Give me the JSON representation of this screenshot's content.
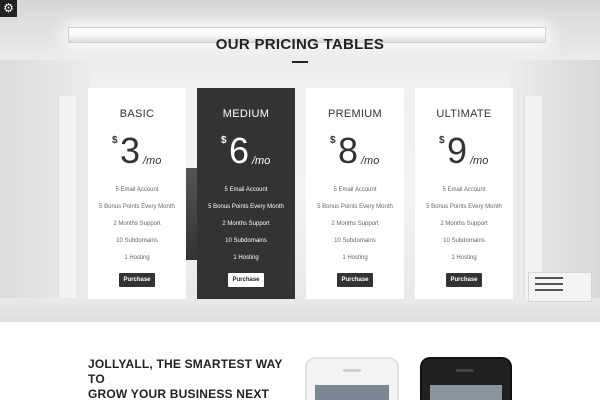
{
  "toolbar": {
    "settings_icon": "gear-icon"
  },
  "pricing": {
    "title": "OUR PRICING TABLES",
    "plans": [
      {
        "name": "BASIC",
        "currency": "$",
        "price": "3",
        "period": "/mo",
        "featured": false,
        "features": [
          "5 Email Account",
          "5 Bonus Points Every Month",
          "2 Months Support",
          "10 Subdomains",
          "1 Hosting"
        ],
        "button_label": "Purchase"
      },
      {
        "name": "MEDIUM",
        "currency": "$",
        "price": "6",
        "period": "/mo",
        "featured": true,
        "features": [
          "5 Email Account",
          "5 Bonus Points Every Month",
          "2 Months Support",
          "10 Subdomains",
          "1 Hosting"
        ],
        "button_label": "Purchase"
      },
      {
        "name": "PREMIUM",
        "currency": "$",
        "price": "8",
        "period": "/mo",
        "featured": false,
        "features": [
          "5 Email Account",
          "5 Bonus Points Every Month",
          "2 Months Support",
          "10 Subdomains",
          "1 Hosting"
        ],
        "button_label": "Purchase"
      },
      {
        "name": "ULTIMATE",
        "currency": "$",
        "price": "9",
        "period": "/mo",
        "featured": false,
        "features": [
          "5 Email Account",
          "5 Bonus Points Every Month",
          "2 Months Support",
          "10 Subdomains",
          "1 Hosting"
        ],
        "button_label": "Purchase"
      }
    ]
  },
  "promo": {
    "tagline_line1": "JOLLYALL, THE SMARTEST WAY TO",
    "tagline_line2": "GROW YOUR BUSINESS NEXT LEVEL!"
  },
  "colors": {
    "featured_background": "#333333",
    "card_background": "#ffffff",
    "button_dark": "#333333"
  }
}
